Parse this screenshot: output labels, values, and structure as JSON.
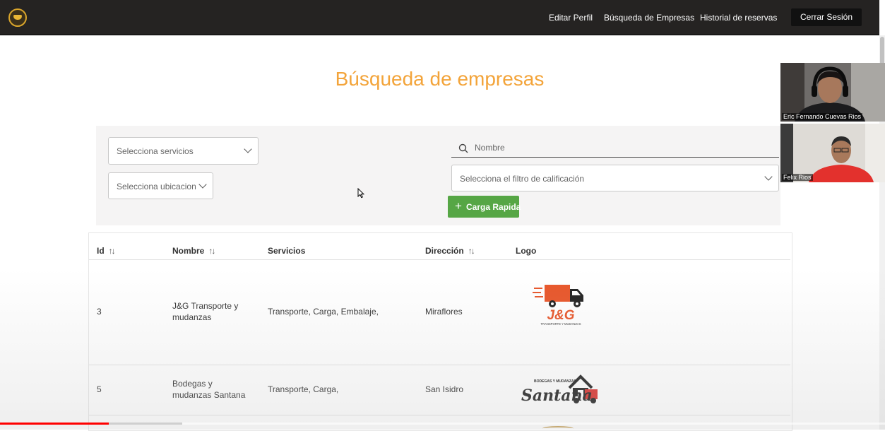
{
  "nav": {
    "links": [
      "Editar Perfil",
      "Búsqueda de Empresas",
      "Historial de reservas"
    ],
    "logout": "Cerrar Sesión"
  },
  "page": {
    "title": "Búsqueda de empresas"
  },
  "filters": {
    "services_placeholder": "Selecciona servicios",
    "location_placeholder": "Selecciona ubicacion",
    "name_placeholder": "Nombre",
    "rating_placeholder": "Selecciona el filtro de calificación",
    "quick_load_label": "Carga Rapida"
  },
  "table": {
    "headers": [
      "Id",
      "Nombre",
      "Servicios",
      "Dirección",
      "Logo"
    ],
    "rows": [
      {
        "id": "3",
        "name": "J&G Transporte y mudanzas",
        "services": "Transporte, Carga, Embalaje,",
        "address": "Miraflores",
        "logo": {
          "text": "J&G",
          "subtext": "TRANSPORTE Y MUDANZAS",
          "color": "#e8562a"
        }
      },
      {
        "id": "5",
        "name": "Bodegas y mudanzas Santana",
        "services": "Transporte, Carga,",
        "address": "San Isidro",
        "logo": {
          "text": "Santana",
          "subtext": "BODEGAS Y MUDANZAS",
          "color": "#d9322e"
        }
      }
    ]
  },
  "participants": [
    {
      "name": "Eric Fernando Cuevas Rios"
    },
    {
      "name": "Felix Rios"
    }
  ],
  "video": {
    "played_fraction": 0.123,
    "buffered_fraction": 0.206
  },
  "colors": {
    "title": "#f3a43a",
    "button_green": "#56a645",
    "navbar": "#252322"
  }
}
